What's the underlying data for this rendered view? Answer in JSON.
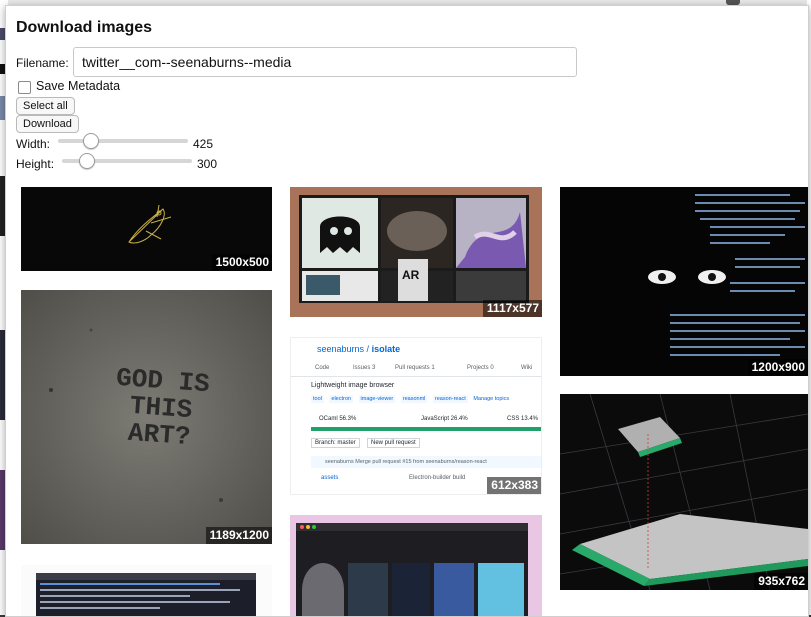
{
  "dialog": {
    "title": "Download images",
    "filename_label": "Filename:",
    "filename_value": "twitter__com--seenaburns--media",
    "save_metadata_label": "Save Metadata",
    "save_metadata_checked": false,
    "select_all_label": "Select all",
    "download_label": "Download",
    "width_label": "Width:",
    "width_value": "425",
    "height_label": "Height:",
    "height_value": "300"
  },
  "images": [
    {
      "dims": "1500x500"
    },
    {
      "dims": "1189x1200"
    },
    {
      "dims": ""
    },
    {
      "dims": "1117x577"
    },
    {
      "dims": "612x383"
    },
    {
      "dims": ""
    },
    {
      "dims": "1200x900"
    },
    {
      "dims": "935x762"
    }
  ],
  "screenshots": {
    "repo_owner": "seenaburns",
    "repo_name": "isolate",
    "tabs": [
      "Code",
      "Issues 3",
      "Pull requests 1",
      "Projects 0",
      "Wiki"
    ],
    "description": "Lightweight image browser",
    "topics": [
      "tool",
      "electron",
      "image-viewer",
      "reasonml",
      "reason-react",
      "Manage topics"
    ],
    "languages": [
      "OCaml 56.3%",
      "JavaScript 26.4%",
      "CSS 13.4%"
    ],
    "branch": "Branch: master",
    "new_pr": "New pull request",
    "commit": "seenaburns Merge pull request #15 from seenaburns/reason-react",
    "folder": "assets",
    "folder_msg": "Electron-builder build",
    "art_text": "GOD IS THIS ART?"
  },
  "colors": {
    "accent": "#0366d6",
    "green": "#22a06b"
  }
}
